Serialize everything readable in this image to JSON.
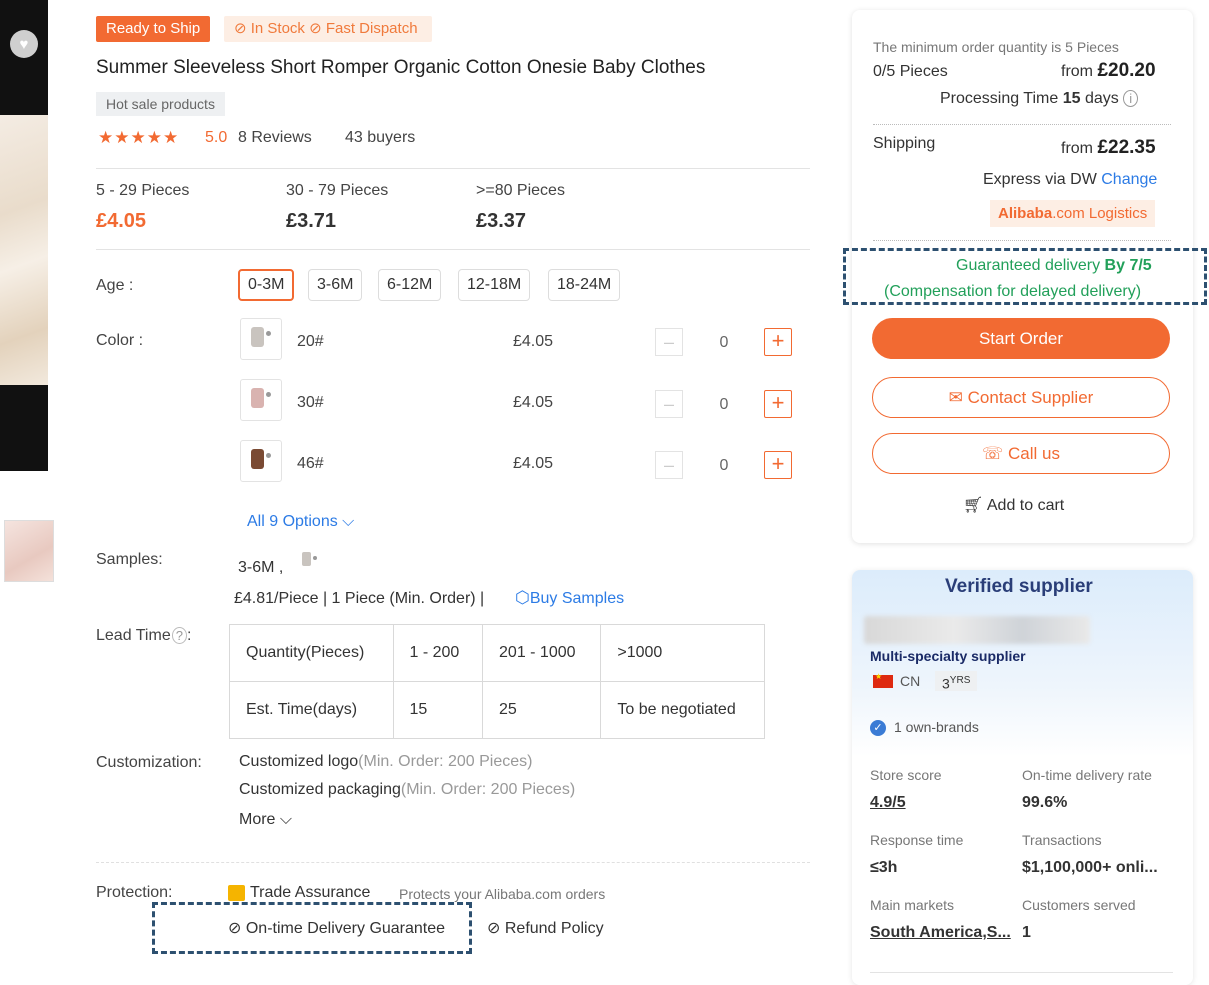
{
  "badges": {
    "ready_to_ship": "Ready to Ship",
    "in_stock": "⊘ In Stock ⊘ Fast Dispatch"
  },
  "product": {
    "title": "Summer Sleeveless Short Romper Organic Cotton Onesie Baby Clothes",
    "hot_tag": "Hot sale products",
    "stars": "★★★★★",
    "rating": "5.0",
    "reviews": "8 Reviews",
    "buyers": "43 buyers"
  },
  "price_tiers": [
    {
      "qty": "5 - 29 Pieces",
      "price": "£4.05"
    },
    {
      "qty": "30 - 79 Pieces",
      "price": "£3.71"
    },
    {
      "qty": ">=80 Pieces",
      "price": "£3.37"
    }
  ],
  "age": {
    "label": "Age :",
    "options": [
      "0-3M",
      "3-6M",
      "6-12M",
      "12-18M",
      "18-24M"
    ],
    "selected": "0-3M"
  },
  "color": {
    "label": "Color :",
    "items": [
      {
        "name": "20#",
        "price": "£4.05",
        "qty": "0",
        "swatch": "#c9c4bf"
      },
      {
        "name": "30#",
        "price": "£4.05",
        "qty": "0",
        "swatch": "#d9b3b0"
      },
      {
        "name": "46#",
        "price": "£4.05",
        "qty": "0",
        "swatch": "#7a4a33"
      }
    ],
    "minus": "–",
    "plus": "+",
    "all_options": "All 9 Options ⌵"
  },
  "samples": {
    "label": "Samples:",
    "variant": "3-6M ,",
    "detail": "£4.81/Piece | 1 Piece (Min. Order) |",
    "buy_link": "Buy Samples"
  },
  "lead_time": {
    "label": "Lead Time",
    "header": [
      "Quantity(Pieces)",
      "1 - 200",
      "201 - 1000",
      ">1000"
    ],
    "row": [
      "Est. Time(days)",
      "15",
      "25",
      "To be negotiated"
    ]
  },
  "customization": {
    "label": "Customization:",
    "items": [
      {
        "name": "Customized logo",
        "note": "(Min. Order: 200 Pieces)"
      },
      {
        "name": "Customized packaging",
        "note": "(Min. Order: 200 Pieces)"
      }
    ],
    "more": "More ⌵"
  },
  "protection": {
    "label": "Protection:",
    "trade_assurance": "Trade Assurance",
    "trade_note": "Protects your Alibaba.com orders",
    "on_time": "On-time Delivery Guarantee",
    "refund": "Refund Policy"
  },
  "order_card": {
    "moq_note": "The minimum order quantity is 5 Pieces",
    "pieces": "0/5 Pieces",
    "from_label": "from",
    "price_from": "£20.20",
    "processing_label": "Processing Time",
    "processing_days": "15",
    "processing_unit": "days",
    "shipping_label": "Shipping",
    "shipping_from": "£22.35",
    "express": "Express via DW",
    "change": "Change",
    "logistics_brand": "Alibaba",
    "logistics_rest": ".com Logistics",
    "guarantee_text": "Guaranteed delivery",
    "guarantee_date": "By 7/5",
    "compensation": "(Compensation for delayed delivery)",
    "start_order": "Start Order",
    "contact_supplier": "Contact Supplier",
    "call_us": "Call us",
    "add_to_cart": "Add to cart"
  },
  "supplier": {
    "verified": "Verified supplier",
    "type": "Multi-specialty supplier",
    "country": "CN",
    "years": "3",
    "years_unit": "YRS",
    "own_brands": "1 own-brands",
    "store_score_label": "Store score",
    "store_score": "4.9/5",
    "on_time_label": "On-time delivery rate",
    "on_time": "99.6%",
    "response_label": "Response time",
    "response": "≤3h",
    "transactions_label": "Transactions",
    "transactions": "$1,100,000+ onli...",
    "markets_label": "Main markets",
    "markets": "South America,S...",
    "customers_label": "Customers served",
    "customers": "1"
  },
  "colors": {
    "accent": "#f26a32",
    "link": "#2c7be5",
    "guarantee_green": "#22a05a",
    "highlight_box": "#2d5070"
  }
}
